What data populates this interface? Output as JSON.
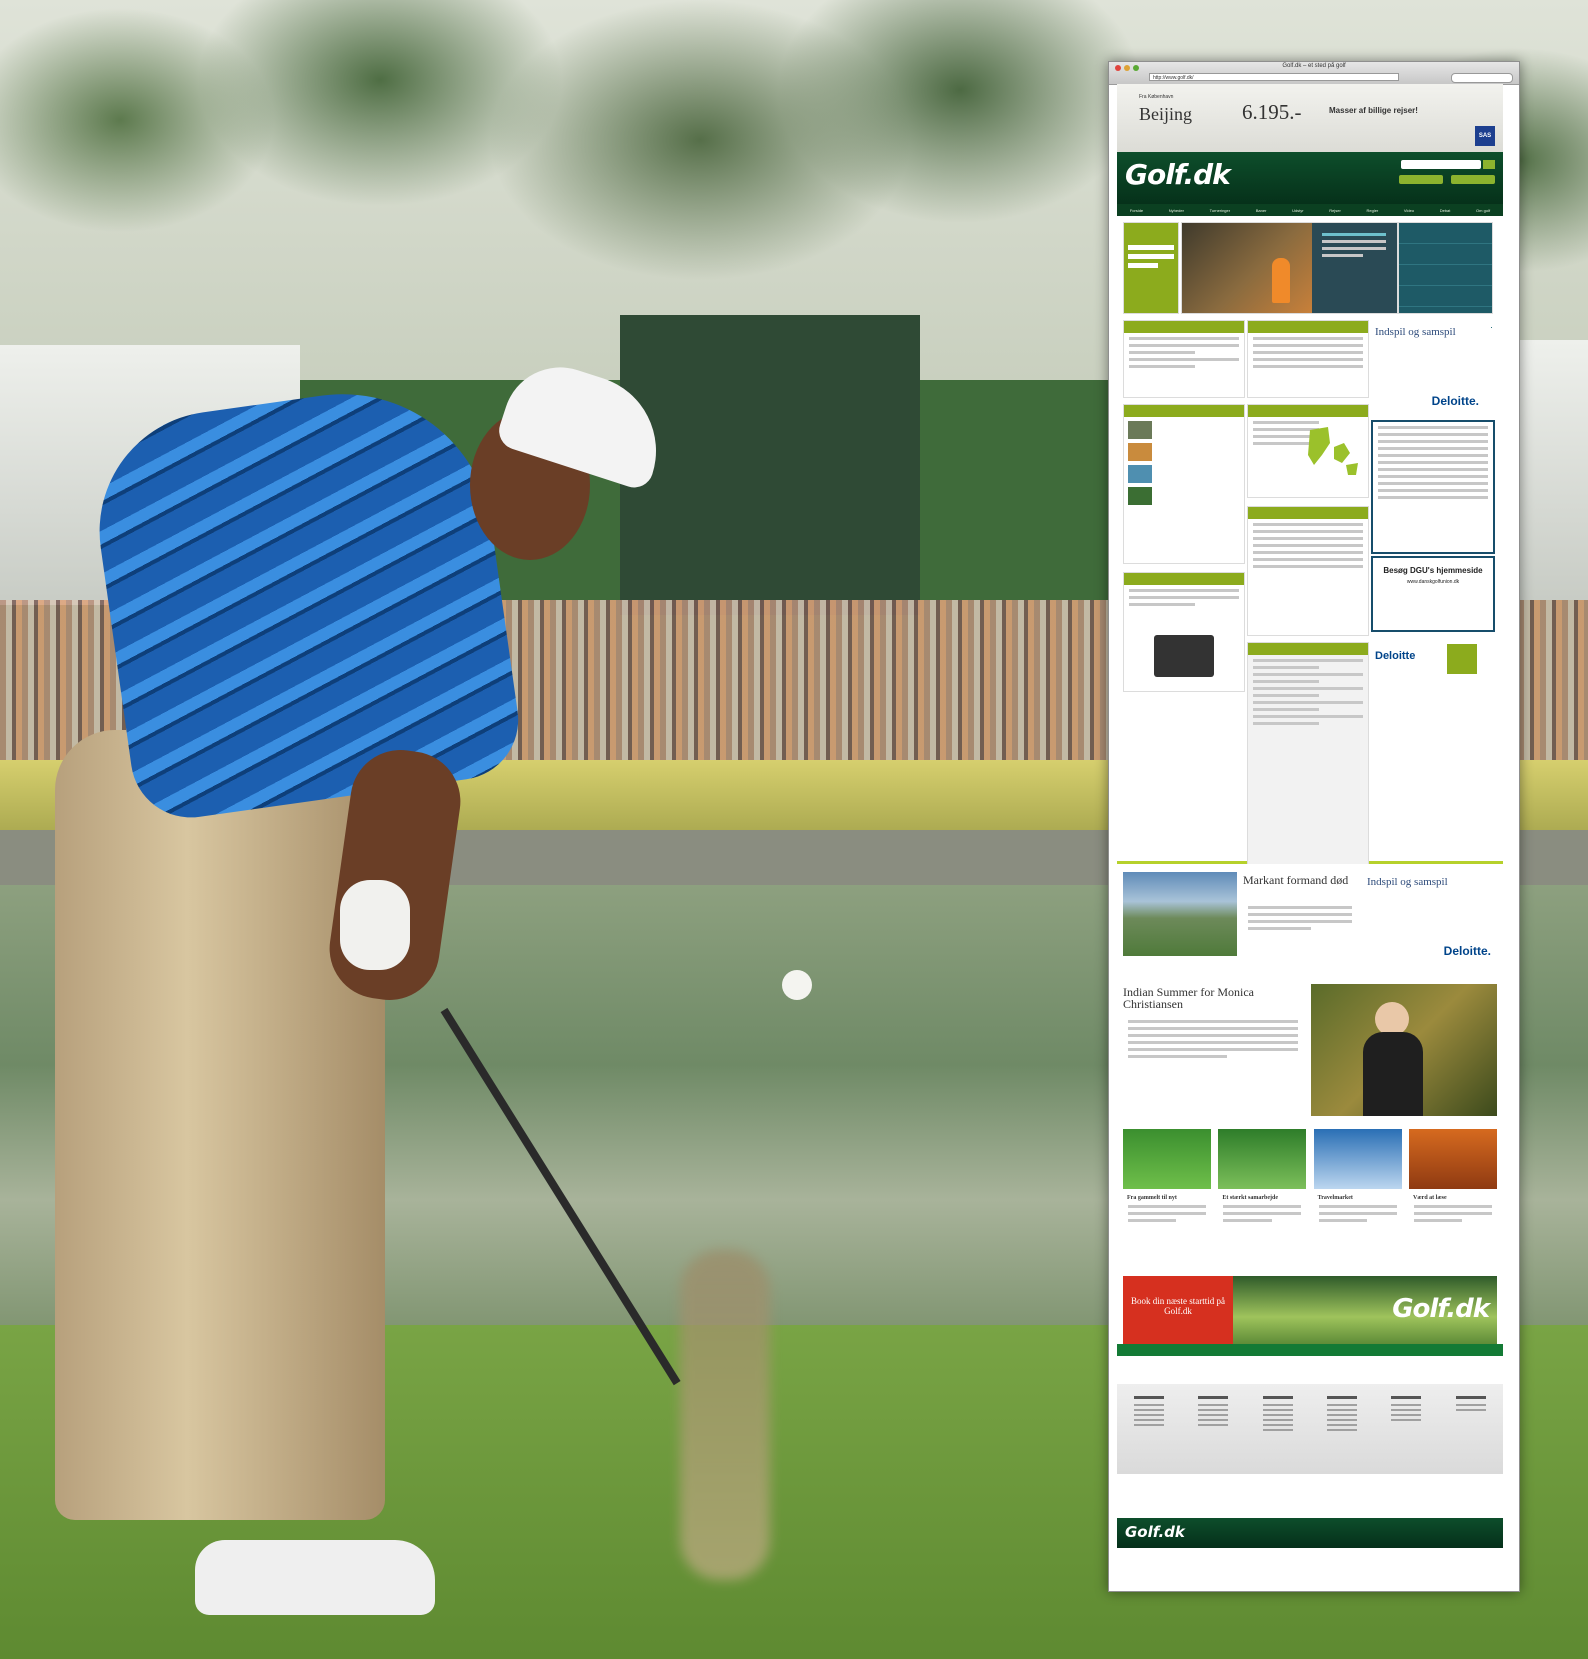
{
  "window": {
    "title": "Golf.dk – et sted på golf",
    "url": "http://www.golf.dk/"
  },
  "ad_banner": {
    "from_label": "Fra København",
    "city": "Beijing",
    "price": "6.195.-",
    "slogan": "Masser af billige rejser!",
    "airline_logo": "SAS"
  },
  "header": {
    "brand": "Golf.dk",
    "nav": [
      "Forside",
      "Nyheder",
      "Turneringer",
      "Baner",
      "Udstyr",
      "Rejser",
      "Regler",
      "Video",
      "Debat",
      "Om golf"
    ]
  },
  "sections": {
    "indspil_ad_1": "Indspil og samspil",
    "indspil_ad_2": "Indspil og samspil",
    "deloitte_1": "Deloitte.",
    "deloitte_2": "Deloitte",
    "deloitte_3": "Deloitte.",
    "dgu_visit": "Besøg DGU's hjemmeside",
    "dgu_url": "www.danskgolfunion.dk"
  },
  "lower": {
    "article1_title": "Markant formand død",
    "article2_title": "Indian Summer for Monica Christiansen",
    "tiles": [
      {
        "title": "Fra gammelt til nyt",
        "color1": "#3b8f2f",
        "color2": "#e8e8e8"
      },
      {
        "title": "Et stærkt samarbejde",
        "color1": "#2e7d2a",
        "color2": "#d24a3a"
      },
      {
        "title": "Travelmarket",
        "color1": "#2a6fb5",
        "color2": "#f0f0f0"
      },
      {
        "title": "Værd at læse",
        "color1": "#d66a1f",
        "color2": "#2b1a12"
      }
    ],
    "promo_text": "Book din næste starttid på Golf.dk",
    "promo_logo": "Golf.dk"
  },
  "footer": {
    "brand": "Golf.dk"
  },
  "colors": {
    "brand_green": "#0d4e2b",
    "accent_lime": "#8cab1d",
    "promo_red": "#d6301f"
  }
}
